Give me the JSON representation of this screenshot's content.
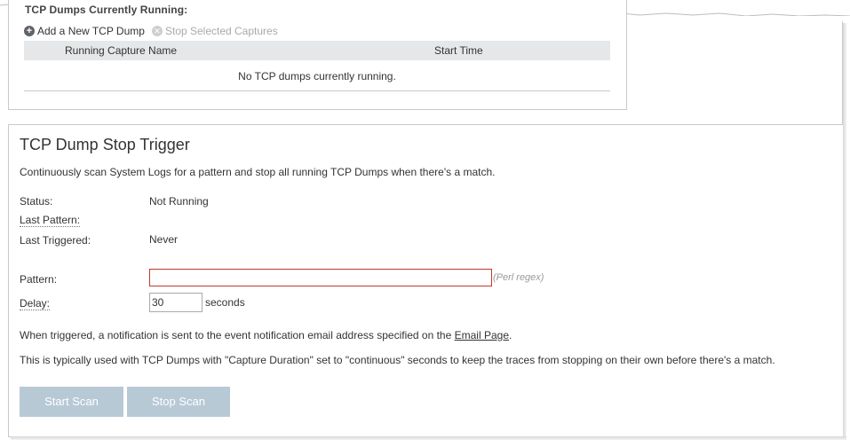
{
  "running_panel": {
    "title": "TCP Dumps Currently Running:",
    "toolbar": {
      "add_label": "Add a New TCP Dump",
      "stop_label": "Stop Selected Captures"
    },
    "table": {
      "columns": [
        "Running Capture Name",
        "Start Time"
      ],
      "empty_message": "No TCP dumps currently running."
    }
  },
  "stop_trigger": {
    "title": "TCP Dump Stop Trigger",
    "description": "Continuously scan System Logs for a pattern and stop all running TCP Dumps when there's a match.",
    "status_label": "Status:",
    "status_value": "Not Running",
    "last_pattern_label": "Last Pattern:",
    "last_pattern_value": "",
    "last_triggered_label": "Last Triggered:",
    "last_triggered_value": "Never",
    "pattern_label": "Pattern:",
    "pattern_value": "",
    "pattern_hint": "(Perl regex)",
    "delay_label": "Delay:",
    "delay_value": "30",
    "delay_unit": "seconds",
    "note1_prefix": "When triggered, a notification is sent to the event notification email address specified on the ",
    "note1_link": "Email Page",
    "note1_suffix": ".",
    "note2": "This is typically used with TCP Dumps with \"Capture Duration\" set to \"continuous\" seconds to keep the traces from stopping on their own before there's a match.",
    "start_button": "Start Scan",
    "stop_button": "Stop Scan"
  },
  "colors": {
    "button_bg": "#b8c9d6",
    "table_header_bg": "#e5e7e9",
    "invalid_border": "#c0392b"
  }
}
